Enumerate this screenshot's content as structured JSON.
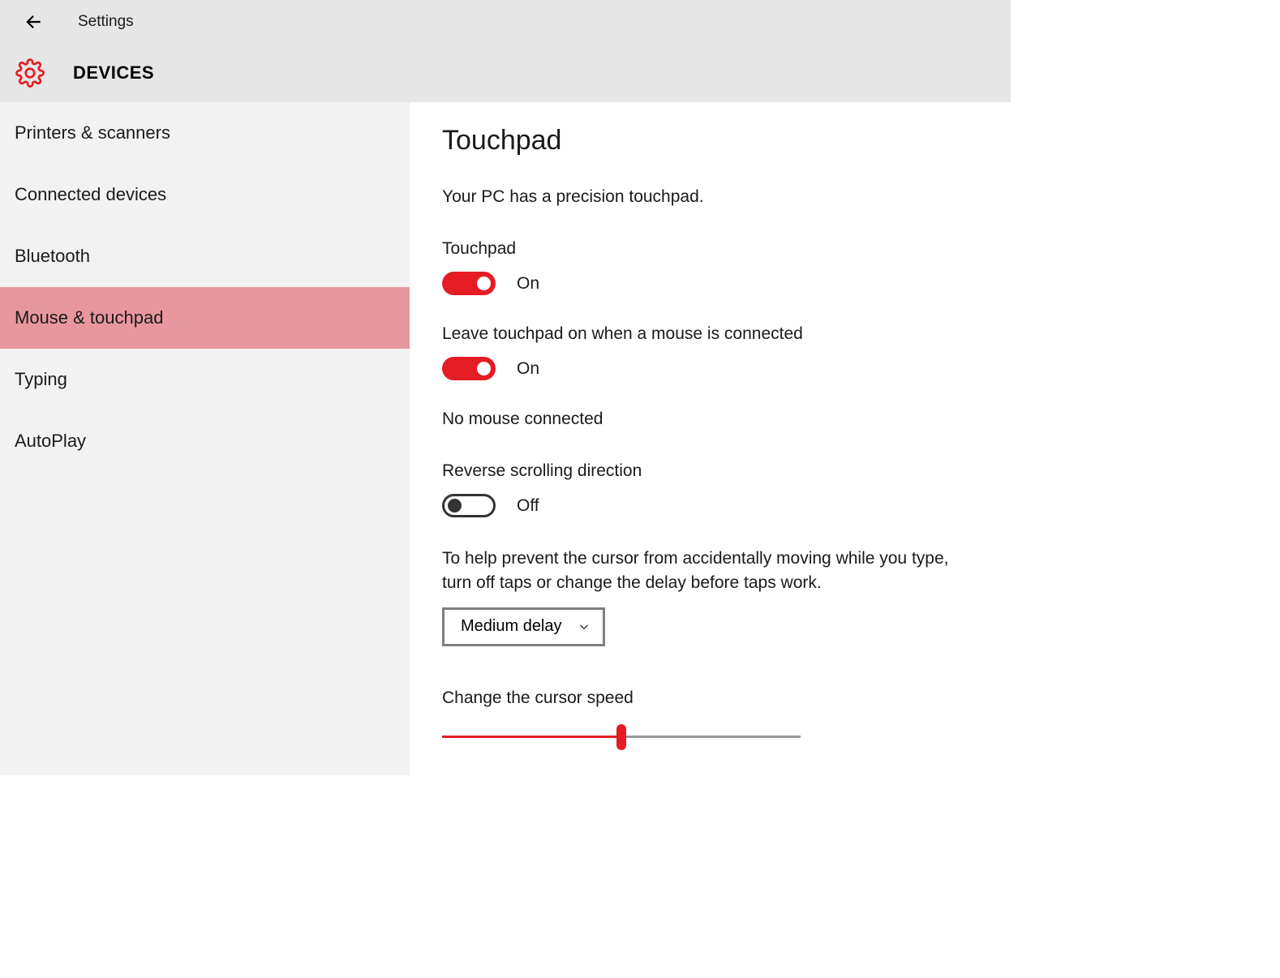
{
  "header": {
    "title": "Settings",
    "section": "DEVICES"
  },
  "colors": {
    "accent": "#e51c23",
    "sidebar_active": "#e8979e"
  },
  "sidebar": {
    "items": [
      {
        "label": "Printers & scanners",
        "active": false
      },
      {
        "label": "Connected devices",
        "active": false
      },
      {
        "label": "Bluetooth",
        "active": false
      },
      {
        "label": "Mouse & touchpad",
        "active": true
      },
      {
        "label": "Typing",
        "active": false
      },
      {
        "label": "AutoPlay",
        "active": false
      }
    ]
  },
  "content": {
    "heading": "Touchpad",
    "subheading": "Your PC has a precision touchpad.",
    "toggles": {
      "touchpad": {
        "label": "Touchpad",
        "on": true,
        "state_text": "On"
      },
      "leave_on": {
        "label": "Leave touchpad on when a mouse is connected",
        "on": true,
        "state_text": "On"
      },
      "reverse_scroll": {
        "label": "Reverse scrolling direction",
        "on": false,
        "state_text": "Off"
      }
    },
    "mouse_status": "No mouse connected",
    "help_text": "To help prevent the cursor from accidentally moving while you type, turn off taps or change the delay before taps work.",
    "delay_dropdown": {
      "selected": "Medium delay"
    },
    "cursor_speed": {
      "label": "Change the cursor speed",
      "value": 50,
      "min": 0,
      "max": 100
    }
  }
}
